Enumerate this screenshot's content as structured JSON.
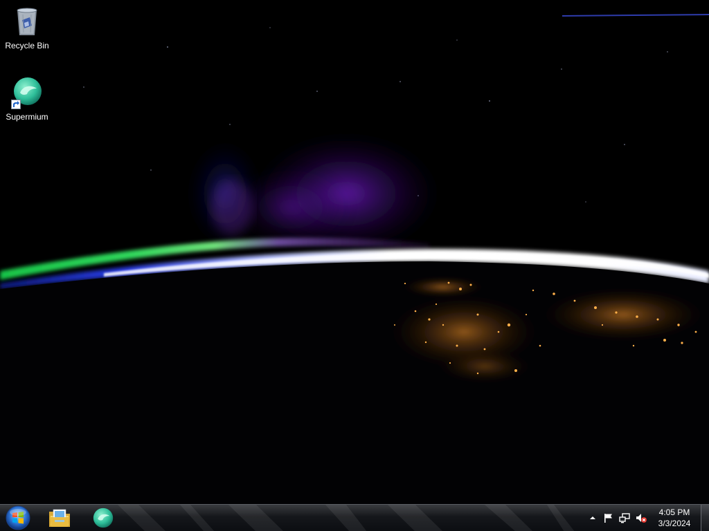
{
  "desktop": {
    "icons": [
      {
        "label": "Recycle Bin",
        "icon": "recycle-bin-icon"
      },
      {
        "label": "Supermium",
        "icon": "supermium-icon",
        "shortcut": true
      }
    ]
  },
  "taskbar": {
    "start": {
      "icon": "windows-start-orb-icon"
    },
    "pinned": [
      {
        "icon": "file-explorer-icon"
      },
      {
        "icon": "supermium-icon"
      }
    ],
    "tray": {
      "icons": [
        "show-hidden-icons-arrow-icon",
        "action-center-flag-icon",
        "network-icon",
        "volume-muted-icon"
      ],
      "time": "4:05 PM",
      "date": "3/3/2024"
    }
  },
  "colors": {
    "aurora_green": "#35d36a",
    "aurora_purple": "#8a2be2",
    "atmosphere_white": "#f2f4ff",
    "atmosphere_blue": "#3a4dff",
    "city_lights": "#ff8a1e"
  }
}
